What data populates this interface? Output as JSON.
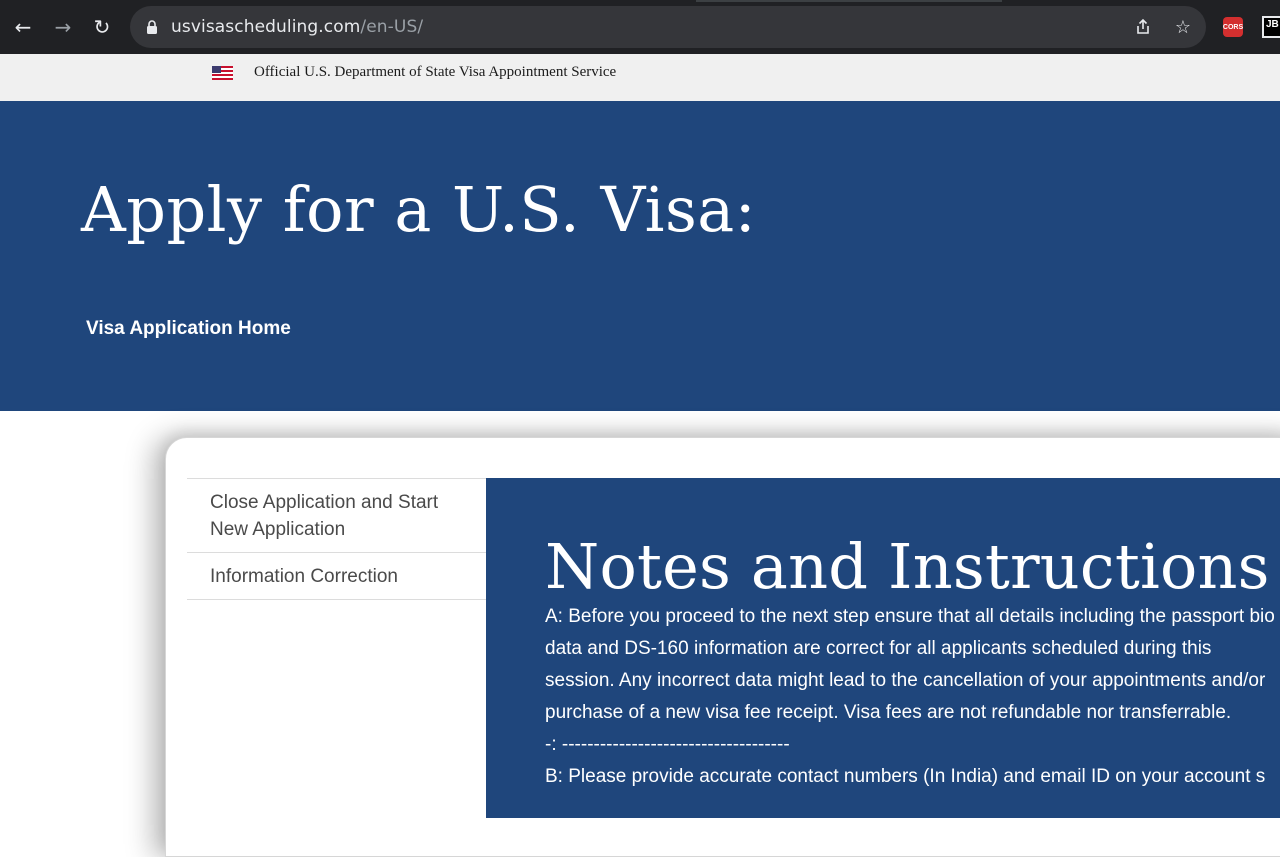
{
  "browser": {
    "url_host": "usvisascheduling.com",
    "url_path": "/en-US/",
    "extensions": [
      {
        "name": "cors-extension",
        "label": "CORS",
        "color": "#d32f2f"
      },
      {
        "name": "jb-extension",
        "label": "JB"
      }
    ]
  },
  "gov_banner": {
    "text": "Official U.S. Department of State Visa Appointment Service"
  },
  "hero": {
    "title": "Apply for a U.S. Visa:",
    "home_link": "Visa Application Home",
    "background_color": "#1f467c"
  },
  "side_menu": {
    "items": [
      {
        "label": "Close Application and Start New Application"
      },
      {
        "label": "Information Correction"
      }
    ]
  },
  "notes": {
    "title": "Notes and Instructions",
    "para_a": "A: Before you proceed to the next step ensure that all details including the passport bio data and DS-160 information are correct for all applicants scheduled during this session. Any incorrect data might lead to the cancellation of your appointments and/or purchase of a new visa fee receipt. Visa fees are not refundable nor transferrable.",
    "separator": "-: ------------------------------------",
    "para_b": "B: Please provide accurate contact numbers (In India) and email ID on your account s"
  }
}
